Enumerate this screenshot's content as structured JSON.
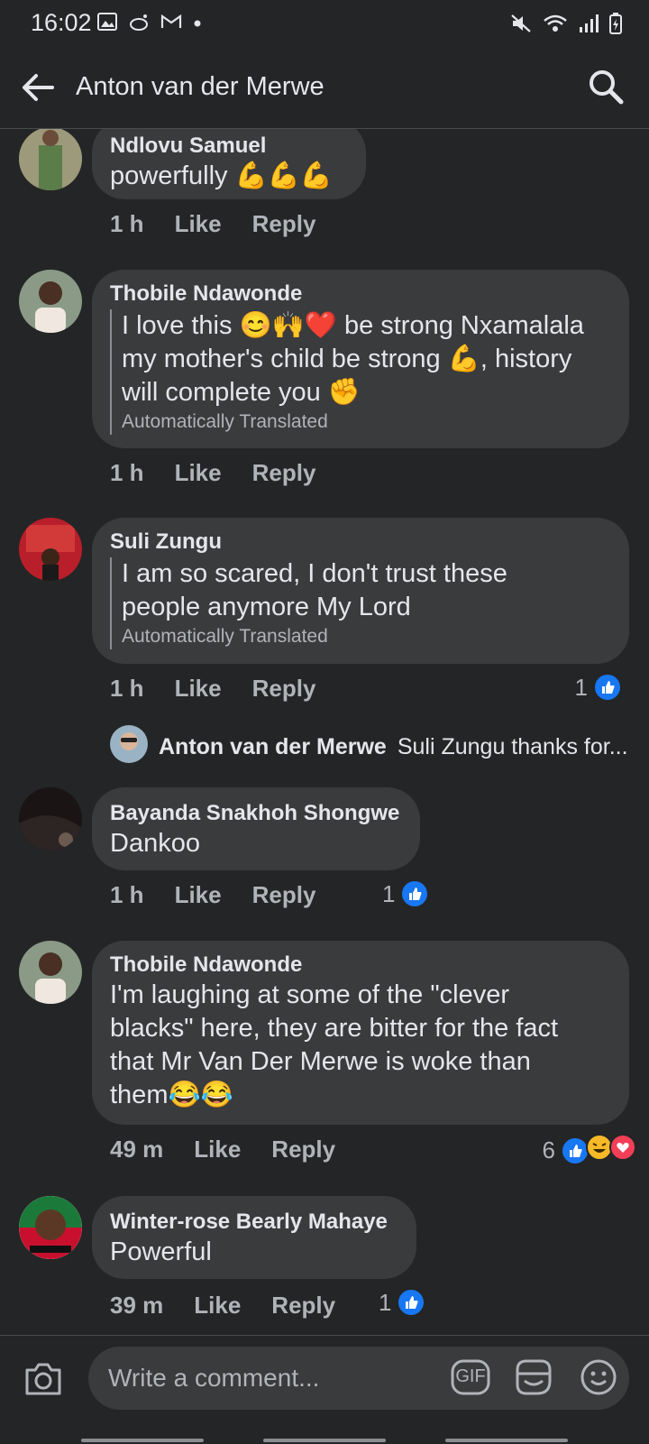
{
  "status": {
    "time": "16:02"
  },
  "header": {
    "title": "Anton van der Merwe"
  },
  "comments": [
    {
      "author": "Ndlovu Samuel",
      "text": "powerfully 💪💪💪",
      "time": "1 h",
      "like": "Like",
      "reply": "Reply"
    },
    {
      "author": "Thobile Ndawonde",
      "line1": "I love this 😊🙌❤️ be strong Nxamalala",
      "line2": "my mother's child be strong 💪, history",
      "line3": "will complete you ✊",
      "note": "Automatically Translated",
      "time": "1 h",
      "like": "Like",
      "reply": "Reply"
    },
    {
      "author": "Suli Zungu",
      "line1": "I am so scared, I don't trust these",
      "line2": "people anymore My Lord",
      "note": "Automatically Translated",
      "time": "1 h",
      "like": "Like",
      "reply": "Reply",
      "reactions": "1",
      "reply_preview": {
        "author": "Anton van der Merwe",
        "text": "Suli Zungu thanks for..."
      }
    },
    {
      "author": "Bayanda Snakhoh Shongwe",
      "text": "Dankoo",
      "time": "1 h",
      "like": "Like",
      "reply": "Reply",
      "reactions": "1"
    },
    {
      "author": "Thobile Ndawonde",
      "line1": "I'm laughing at some of the \"clever",
      "line2": "blacks\" here, they are bitter for the fact",
      "line3": "that Mr Van Der Merwe is woke than",
      "line4": "them😂😂",
      "time": "49 m",
      "like": "Like",
      "reply": "Reply",
      "reactions": "6"
    },
    {
      "author": "Winter-rose Bearly Mahaye",
      "text": "Powerful",
      "time": "39 m",
      "like": "Like",
      "reply": "Reply",
      "reactions": "1"
    }
  ],
  "composer": {
    "placeholder": "Write a comment...",
    "gif_label": "GIF"
  },
  "colors": {
    "background": "#242526",
    "bubble": "#3a3b3c",
    "like_blue": "#1877f2",
    "love_red": "#f33e58",
    "haha_yellow": "#f7b928"
  }
}
